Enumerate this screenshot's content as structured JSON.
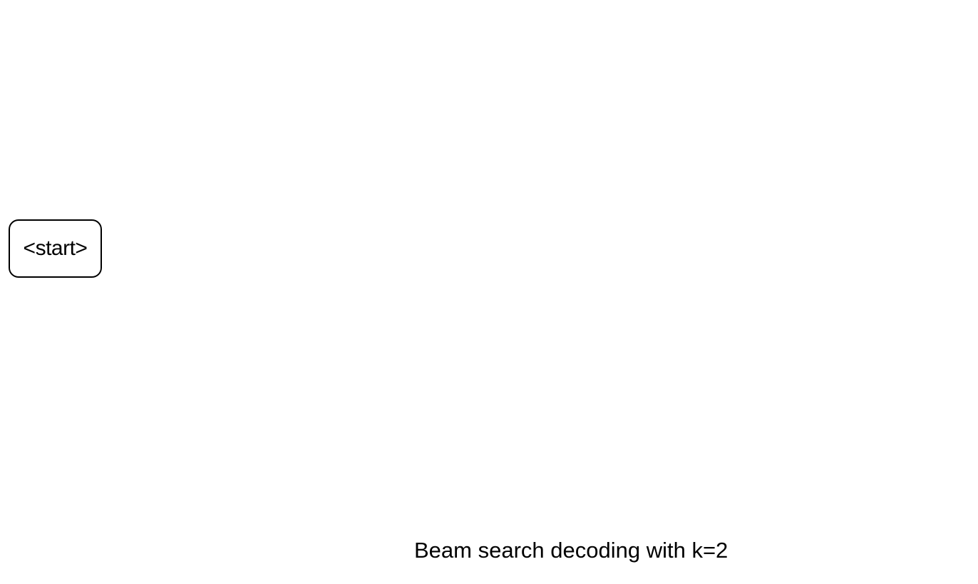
{
  "diagram": {
    "nodes": [
      {
        "id": "start",
        "label": "<start>"
      }
    ],
    "caption": "Beam search decoding with k=2"
  }
}
